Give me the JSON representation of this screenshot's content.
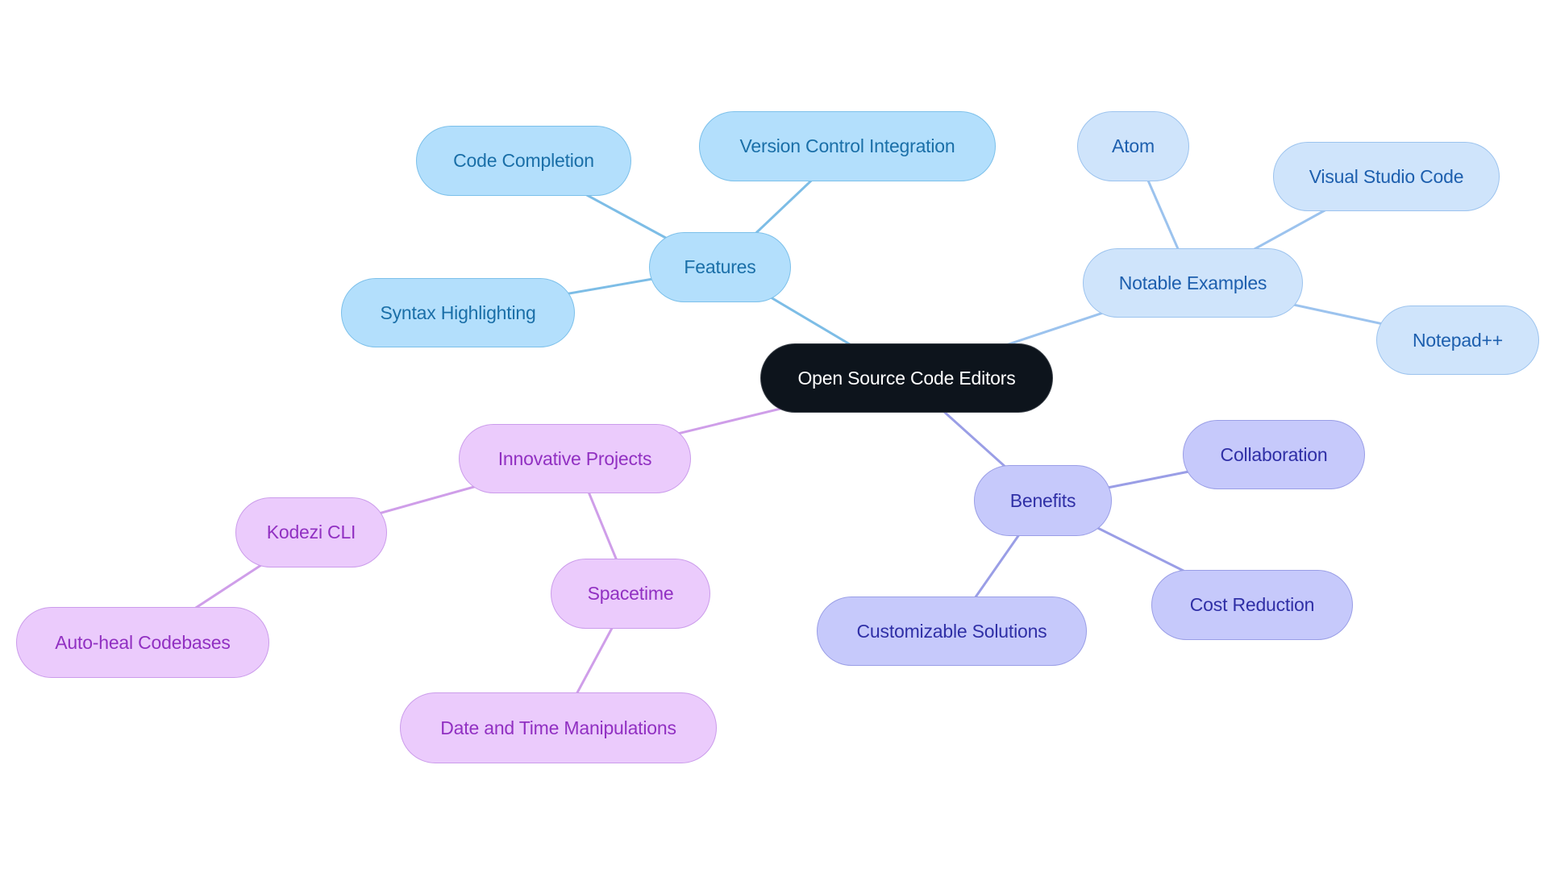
{
  "mindmap": {
    "root": {
      "id": "root",
      "label": "Open Source Code Editors",
      "theme": "root"
    },
    "themes": {
      "root": {
        "fill": "#0d141c",
        "stroke": "#3a4048",
        "text": "#ffffff",
        "edge": "#0d141c"
      },
      "features": {
        "fill": "#b3dffc",
        "stroke": "#7cc0ea",
        "text": "#1a6fa8",
        "edge": "#7dbde6"
      },
      "examples": {
        "fill": "#cfe4fb",
        "stroke": "#9cc3ee",
        "text": "#1d5fae",
        "edge": "#9cc3ee"
      },
      "innovative": {
        "fill": "#ebcbfc",
        "stroke": "#cb9ceb",
        "text": "#9130c2",
        "edge": "#cf9ee9"
      },
      "benefits": {
        "fill": "#c6c9fb",
        "stroke": "#9a9ee6",
        "text": "#2f2fa6",
        "edge": "#9a9ee6"
      }
    },
    "nodes": [
      {
        "id": "features",
        "label": "Features",
        "parent": "root",
        "theme": "features"
      },
      {
        "id": "code-completion",
        "label": "Code Completion",
        "parent": "features",
        "theme": "features"
      },
      {
        "id": "version-control",
        "label": "Version Control Integration",
        "parent": "features",
        "theme": "features"
      },
      {
        "id": "syntax-highlighting",
        "label": "Syntax Highlighting",
        "parent": "features",
        "theme": "features"
      },
      {
        "id": "notable-examples",
        "label": "Notable Examples",
        "parent": "root",
        "theme": "examples"
      },
      {
        "id": "atom",
        "label": "Atom",
        "parent": "notable-examples",
        "theme": "examples"
      },
      {
        "id": "vscode",
        "label": "Visual Studio Code",
        "parent": "notable-examples",
        "theme": "examples"
      },
      {
        "id": "notepadpp",
        "label": "Notepad++",
        "parent": "notable-examples",
        "theme": "examples"
      },
      {
        "id": "innovative-projects",
        "label": "Innovative Projects",
        "parent": "root",
        "theme": "innovative"
      },
      {
        "id": "kodezi-cli",
        "label": "Kodezi CLI",
        "parent": "innovative-projects",
        "theme": "innovative"
      },
      {
        "id": "auto-heal",
        "label": "Auto-heal Codebases",
        "parent": "kodezi-cli",
        "theme": "innovative"
      },
      {
        "id": "spacetime",
        "label": "Spacetime",
        "parent": "innovative-projects",
        "theme": "innovative"
      },
      {
        "id": "date-time",
        "label": "Date and Time Manipulations",
        "parent": "spacetime",
        "theme": "innovative"
      },
      {
        "id": "benefits",
        "label": "Benefits",
        "parent": "root",
        "theme": "benefits"
      },
      {
        "id": "collaboration",
        "label": "Collaboration",
        "parent": "benefits",
        "theme": "benefits"
      },
      {
        "id": "cost-reduction",
        "label": "Cost Reduction",
        "parent": "benefits",
        "theme": "benefits"
      },
      {
        "id": "customizable",
        "label": "Customizable Solutions",
        "parent": "benefits",
        "theme": "benefits"
      }
    ]
  }
}
